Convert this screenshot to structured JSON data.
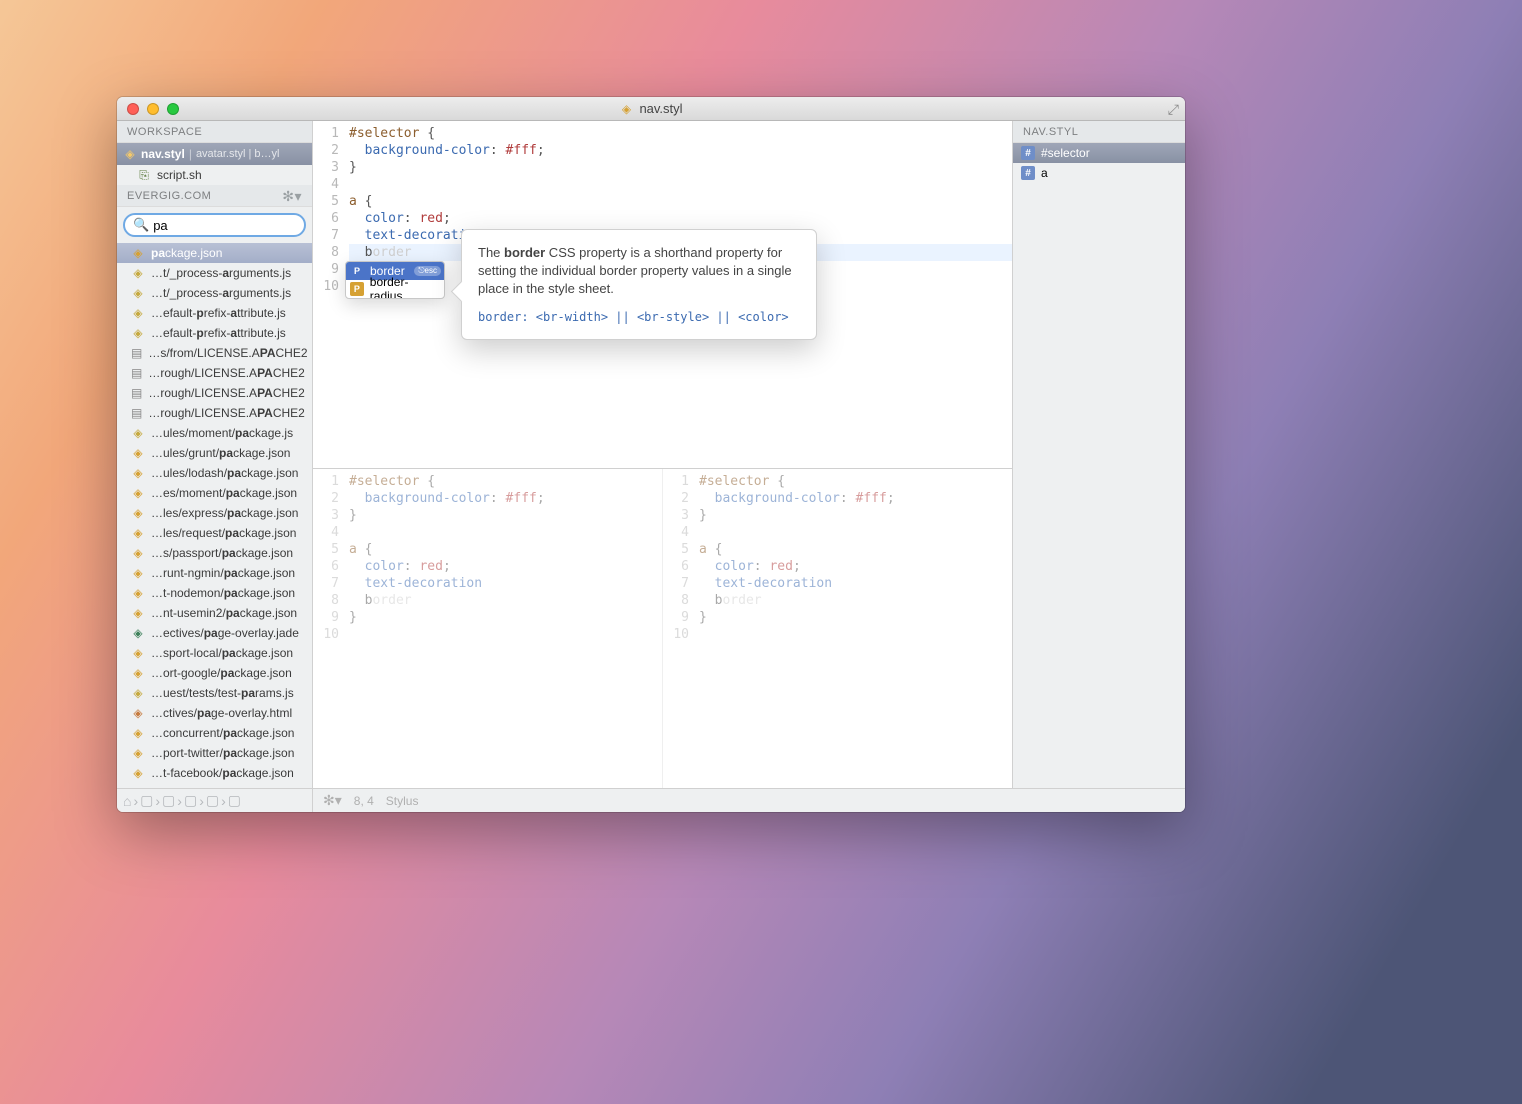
{
  "title": "nav.styl",
  "sidebar": {
    "workspace_label": "WORKSPACE",
    "tabs": {
      "active": "nav.styl",
      "others": "avatar.styl | b…yl"
    },
    "workspace_files": [
      {
        "icon": "sh",
        "name": "script.sh"
      }
    ],
    "project_label": "EVERGIG.COM",
    "search_value": "pa",
    "results": [
      {
        "icon": "json",
        "pre": "",
        "hl": "pa",
        "post": "ckage.json",
        "selected": true
      },
      {
        "icon": "js",
        "pre": "…t/_process-",
        "hl": "a",
        "post": "rguments.js"
      },
      {
        "icon": "js",
        "pre": "…t/_process-",
        "hl": "a",
        "post": "rguments.js"
      },
      {
        "icon": "js",
        "pre": "…efault-",
        "hl": "p",
        "post": "refix-",
        "hl2": "a",
        "post2": "ttribute.js"
      },
      {
        "icon": "js",
        "pre": "…efault-",
        "hl": "p",
        "post": "refix-",
        "hl2": "a",
        "post2": "ttribute.js"
      },
      {
        "icon": "txt",
        "pre": "…s/from/LICENSE.A",
        "hl": "PA",
        "post": "CHE2"
      },
      {
        "icon": "txt",
        "pre": "…rough/LICENSE.A",
        "hl": "PA",
        "post": "CHE2"
      },
      {
        "icon": "txt",
        "pre": "…rough/LICENSE.A",
        "hl": "PA",
        "post": "CHE2"
      },
      {
        "icon": "txt",
        "pre": "…rough/LICENSE.A",
        "hl": "PA",
        "post": "CHE2"
      },
      {
        "icon": "js",
        "pre": "…ules/moment/",
        "hl": "pa",
        "post": "ckage.js"
      },
      {
        "icon": "json",
        "pre": "…ules/grunt/",
        "hl": "pa",
        "post": "ckage.json"
      },
      {
        "icon": "json",
        "pre": "…ules/lodash/",
        "hl": "pa",
        "post": "ckage.json"
      },
      {
        "icon": "json",
        "pre": "…es/moment/",
        "hl": "pa",
        "post": "ckage.json"
      },
      {
        "icon": "json",
        "pre": "…les/express/",
        "hl": "pa",
        "post": "ckage.json"
      },
      {
        "icon": "json",
        "pre": "…les/request/",
        "hl": "pa",
        "post": "ckage.json"
      },
      {
        "icon": "json",
        "pre": "…s/passport/",
        "hl": "pa",
        "post": "ckage.json"
      },
      {
        "icon": "json",
        "pre": "…runt-ngmin/",
        "hl": "pa",
        "post": "ckage.json"
      },
      {
        "icon": "json",
        "pre": "…t-nodemon/",
        "hl": "pa",
        "post": "ckage.json"
      },
      {
        "icon": "json",
        "pre": "…nt-usemin2/",
        "hl": "pa",
        "post": "ckage.json"
      },
      {
        "icon": "jade",
        "pre": "…ectives/",
        "hl": "pa",
        "post": "ge-overlay.jade"
      },
      {
        "icon": "json",
        "pre": "…sport-local/",
        "hl": "pa",
        "post": "ckage.json"
      },
      {
        "icon": "json",
        "pre": "…ort-google/",
        "hl": "pa",
        "post": "ckage.json"
      },
      {
        "icon": "js",
        "pre": "…uest/tests/test-",
        "hl": "pa",
        "post": "rams.js"
      },
      {
        "icon": "html",
        "pre": "…ctives/",
        "hl": "pa",
        "post": "ge-overlay.html"
      },
      {
        "icon": "json",
        "pre": "…concurrent/",
        "hl": "pa",
        "post": "ckage.json"
      },
      {
        "icon": "json",
        "pre": "…port-twitter/",
        "hl": "pa",
        "post": "ckage.json"
      },
      {
        "icon": "json",
        "pre": "…t-facebook/",
        "hl": "pa",
        "post": "ckage.json"
      }
    ]
  },
  "editor": {
    "lines": [
      {
        "n": 1,
        "t": "#selector {"
      },
      {
        "n": 2,
        "t": "  background-color: #fff;"
      },
      {
        "n": 3,
        "t": "}"
      },
      {
        "n": 4,
        "t": ""
      },
      {
        "n": 5,
        "t": "a {"
      },
      {
        "n": 6,
        "t": "  color: red;"
      },
      {
        "n": 7,
        "t": "  text-decoration"
      },
      {
        "n": 8,
        "t": "  border",
        "ghost": "order",
        "typed": "b",
        "current": true
      },
      {
        "n": 9,
        "t": "}"
      },
      {
        "n": 10,
        "t": ""
      }
    ]
  },
  "autocomplete": {
    "items": [
      {
        "badge": "P",
        "label": "border",
        "selected": true,
        "pill": "⎋esc"
      },
      {
        "badge": "Pg",
        "label": "border-radius"
      }
    ]
  },
  "tooltip": {
    "bold": "border",
    "desc_pre": "The ",
    "desc_post": " CSS property is a shorthand property for setting the individual border property values in a single place in the style sheet.",
    "syntax": "border:  <br-width> || <br-style> || <color>"
  },
  "outline": {
    "header": "NAV.STYL",
    "items": [
      {
        "label": "#selector",
        "selected": true
      },
      {
        "label": "a"
      }
    ]
  },
  "status": {
    "pos": "8, 4",
    "lang": "Stylus"
  }
}
